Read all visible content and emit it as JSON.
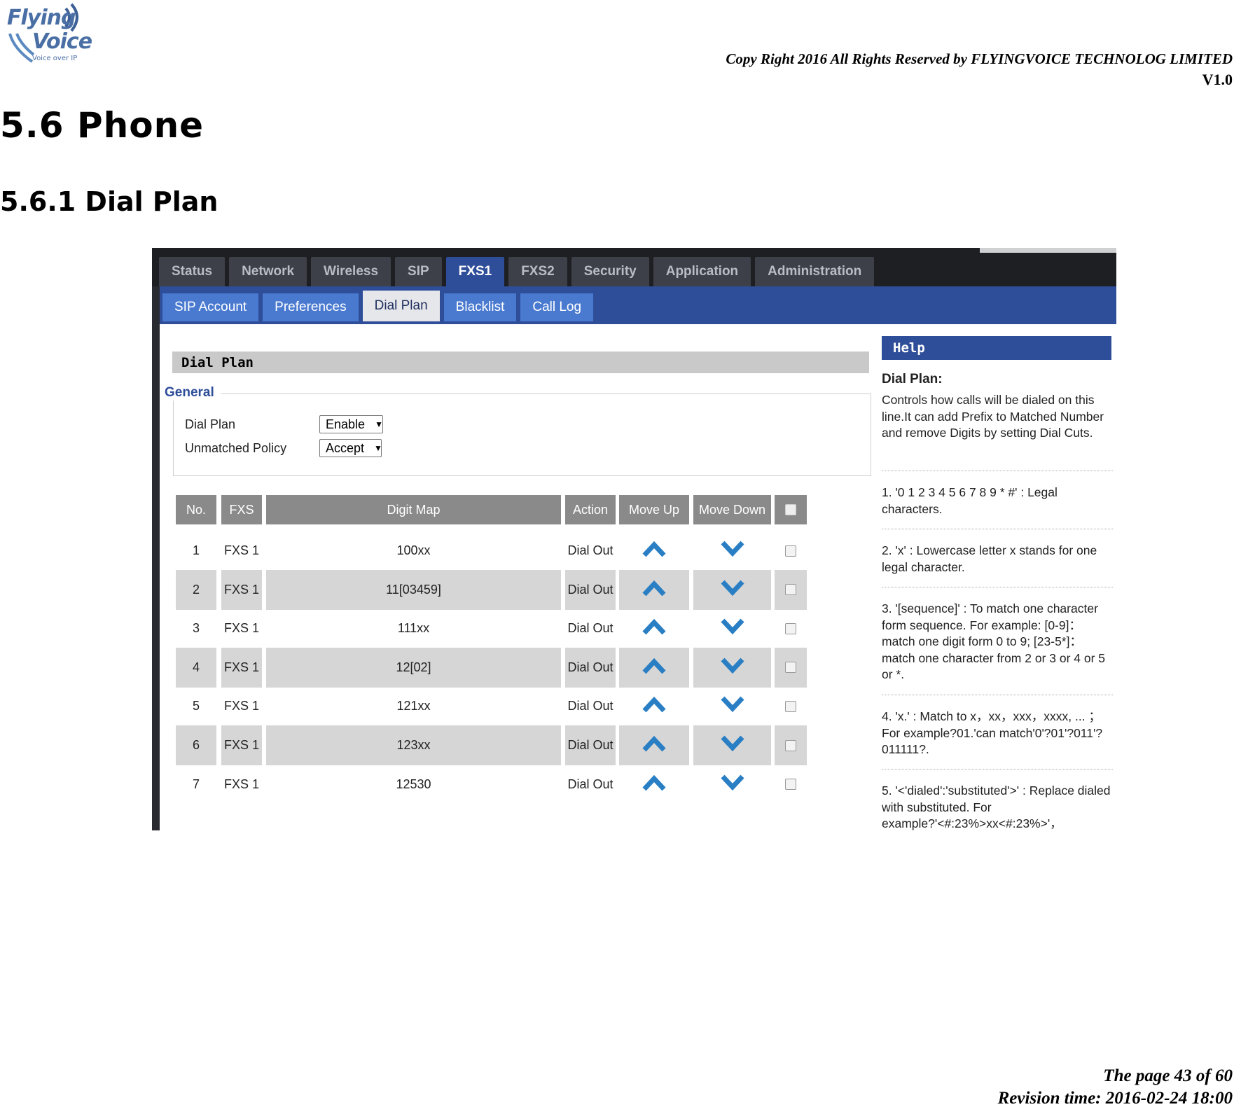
{
  "doc": {
    "logo": {
      "line1": "Flying",
      "line2": "Voice",
      "line3": "Voice over IP"
    },
    "copyright": "Copy Right 2016 All Rights Reserved by FLYINGVOICE TECHNOLOG LIMITED",
    "version": "V1.0",
    "heading1": "5.6 Phone",
    "heading2": "5.6.1 Dial Plan",
    "page": "The page 43 of 60",
    "revision": "Revision time: 2016-02-24 18:00"
  },
  "ui": {
    "main_tabs": [
      "Status",
      "Network",
      "Wireless",
      "SIP",
      "FXS1",
      "FXS2",
      "Security",
      "Application",
      "Administration"
    ],
    "active_main_tab": "FXS1",
    "sub_tabs": [
      "SIP Account",
      "Preferences",
      "Dial Plan",
      "Blacklist",
      "Call Log"
    ],
    "active_sub_tab": "Dial Plan",
    "section_title": "Dial Plan",
    "general_label": "General",
    "fields": {
      "dial_plan_label": "Dial Plan",
      "dial_plan_value": "Enable",
      "unmatched_label": "Unmatched Policy",
      "unmatched_value": "Accept"
    },
    "table": {
      "headers": {
        "no": "No.",
        "fxs": "FXS",
        "digit_map": "Digit Map",
        "action": "Action",
        "move_up": "Move Up",
        "move_down": "Move Down"
      },
      "rows": [
        {
          "no": "1",
          "fxs": "FXS 1",
          "digit_map": "100xx",
          "action": "Dial Out"
        },
        {
          "no": "2",
          "fxs": "FXS 1",
          "digit_map": "11[03459]",
          "action": "Dial Out"
        },
        {
          "no": "3",
          "fxs": "FXS 1",
          "digit_map": "111xx",
          "action": "Dial Out"
        },
        {
          "no": "4",
          "fxs": "FXS 1",
          "digit_map": "12[02]",
          "action": "Dial Out"
        },
        {
          "no": "5",
          "fxs": "FXS 1",
          "digit_map": "121xx",
          "action": "Dial Out"
        },
        {
          "no": "6",
          "fxs": "FXS 1",
          "digit_map": "123xx",
          "action": "Dial Out"
        },
        {
          "no": "7",
          "fxs": "FXS 1",
          "digit_map": "12530",
          "action": "Dial Out"
        }
      ]
    },
    "help": {
      "header": "Help",
      "title": "Dial Plan:",
      "intro": "Controls how calls will be dialed on this line.It can add Prefix to Matched Number and remove Digits by setting Dial Cuts.",
      "items": [
        "1. '0 1 2 3 4 5 6 7 8 9 * #' : Legal characters.",
        "2. 'x' : Lowercase letter x stands for one legal character.",
        "3. '[sequence]' : To match one character form sequence. For example: [0-9]：match one digit form 0 to 9; [23-5*]：match one character from 2 or 3 or 4 or 5 or *.",
        "4. 'x.' : Match to x，xx，xxx，xxxx, ... ；For example?01.'can match'0'?01'?011'?011111?.",
        "5. '<'dialed':'substituted'>' : Replace dialed with substituted. For example?'<#:23%>xx<#:23%>'，"
      ]
    },
    "colors": {
      "nav_dark": "#1e1f23",
      "nav_blue": "#2f4e9a",
      "arrow_blue": "#2a7fc4"
    }
  }
}
